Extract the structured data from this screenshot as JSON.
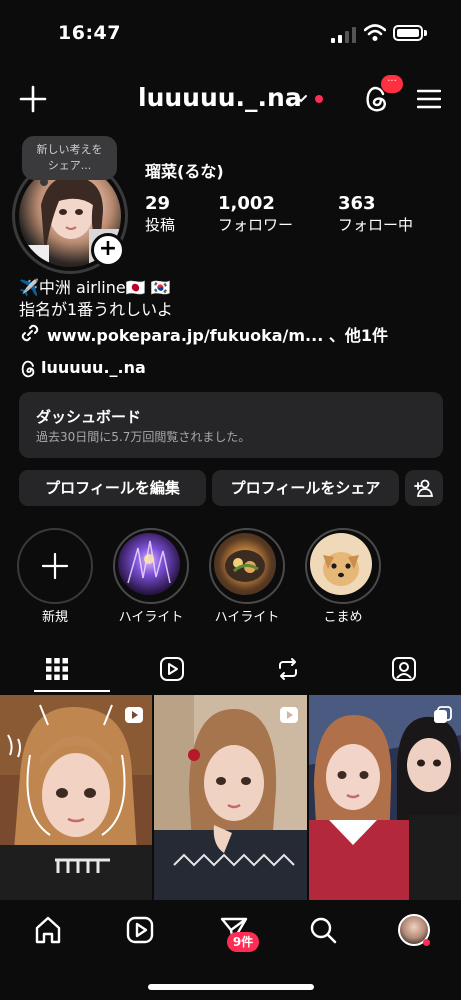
{
  "status_bar": {
    "time": "16:47"
  },
  "header": {
    "username": "luuuuu._.na",
    "threads_badge": "···"
  },
  "profile": {
    "note": "新しい考えをシェア...",
    "note_line1": "新しい考えを",
    "note_line2": "シェア...",
    "display_name": "瑠菜(るな)",
    "stats": [
      {
        "value": "29",
        "label": "投稿"
      },
      {
        "value": "1,002",
        "label": "フォロワー"
      },
      {
        "value": "363",
        "label": "フォロー中"
      }
    ],
    "bio_line1": "✈️中洲 airline🇯🇵 🇰🇷",
    "bio_line2": "指名が1番うれしいよ",
    "link": "www.pokepara.jp/fukuoka/m... 、他1件",
    "threads_handle": "luuuuu._.na"
  },
  "dashboard": {
    "title": "ダッシュボード",
    "subtitle": "過去30日間に5.7万回閲覧されました。"
  },
  "buttons": {
    "edit": "プロフィールを編集",
    "share": "プロフィールをシェア"
  },
  "highlights": [
    {
      "label": "新規"
    },
    {
      "label": "ハイライト"
    },
    {
      "label": "ハイライト"
    },
    {
      "label": "こまめ"
    }
  ],
  "tabs": [
    {
      "icon": "grid-icon",
      "active": true
    },
    {
      "icon": "reels-icon",
      "active": false
    },
    {
      "icon": "repost-icon",
      "active": false
    },
    {
      "icon": "tagged-icon",
      "active": false
    }
  ],
  "bottom_nav": {
    "inbox_badge": "9件"
  },
  "colors": {
    "background": "#0c0c0c",
    "surface": "#262628",
    "badge": "#ff2d55"
  }
}
